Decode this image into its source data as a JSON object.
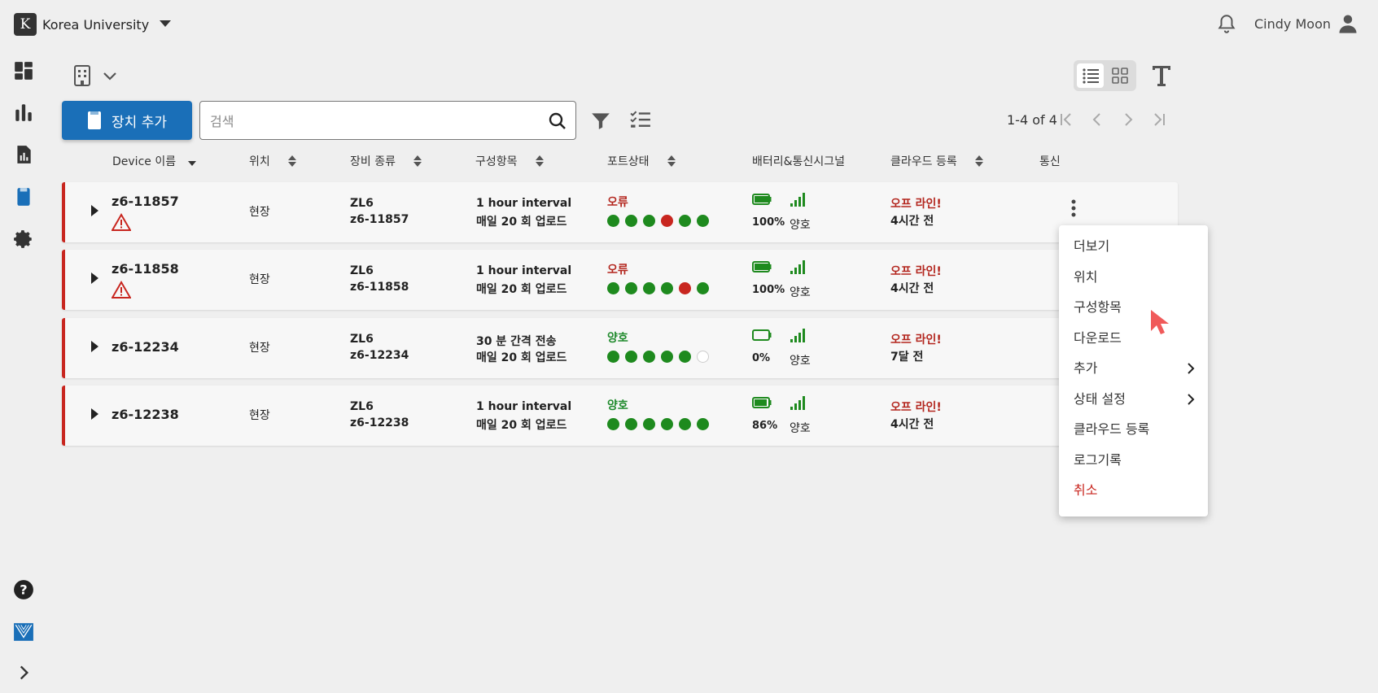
{
  "header": {
    "org_logo_letter": "K",
    "org_name": "Korea University",
    "user_name": "Cindy Moon"
  },
  "toolbar": {
    "add_device_label": "장치 추가",
    "search_placeholder": "검색",
    "pagination": "1-4 of 4"
  },
  "table": {
    "columns": [
      "Device 이름",
      "위치",
      "장비 종류",
      "구성항목",
      "포트상태",
      "배터리&통신시그널",
      "클라우드 등록",
      "통신"
    ],
    "rows": [
      {
        "name": "z6-11857",
        "warning": true,
        "location": "현장",
        "equip_type": "ZL6",
        "equip_id": "z6-11857",
        "config1": "1 hour interval",
        "config2": "매일 20 회 업로드",
        "port_status": "오류",
        "port_status_kind": "error",
        "ports": [
          "g",
          "g",
          "g",
          "r",
          "g",
          "g"
        ],
        "battery": "100%",
        "battery_level": 1.0,
        "signal": "양호",
        "cloud_status": "오프 라인!",
        "cloud_time": "4시간 전"
      },
      {
        "name": "z6-11858",
        "warning": true,
        "location": "현장",
        "equip_type": "ZL6",
        "equip_id": "z6-11858",
        "config1": "1 hour interval",
        "config2": "매일 20 회 업로드",
        "port_status": "오류",
        "port_status_kind": "error",
        "ports": [
          "g",
          "g",
          "g",
          "g",
          "r",
          "g"
        ],
        "battery": "100%",
        "battery_level": 1.0,
        "signal": "양호",
        "cloud_status": "오프 라인!",
        "cloud_time": "4시간 전"
      },
      {
        "name": "z6-12234",
        "warning": false,
        "location": "현장",
        "equip_type": "ZL6",
        "equip_id": "z6-12234",
        "config1": "30 분 간격 전송",
        "config2": "매일 20 회 업로드",
        "port_status": "양호",
        "port_status_kind": "ok",
        "ports": [
          "g",
          "g",
          "g",
          "g",
          "g",
          "e"
        ],
        "battery": "0%",
        "battery_level": 0.0,
        "signal": "양호",
        "cloud_status": "오프 라인!",
        "cloud_time": "7달 전"
      },
      {
        "name": "z6-12238",
        "warning": false,
        "location": "현장",
        "equip_type": "ZL6",
        "equip_id": "z6-12238",
        "config1": "1 hour interval",
        "config2": "매일 20 회 업로드",
        "port_status": "양호",
        "port_status_kind": "ok",
        "ports": [
          "g",
          "g",
          "g",
          "g",
          "g",
          "g"
        ],
        "battery": "86%",
        "battery_level": 0.86,
        "signal": "양호",
        "cloud_status": "오프 라인!",
        "cloud_time": "4시간 전"
      }
    ]
  },
  "context_menu": {
    "items": [
      {
        "label": "더보기",
        "submenu": false
      },
      {
        "label": "위치",
        "submenu": false
      },
      {
        "label": "구성항목",
        "submenu": false
      },
      {
        "label": "다운로드",
        "submenu": false
      },
      {
        "label": "추가",
        "submenu": true
      },
      {
        "label": "상태 설정",
        "submenu": true
      },
      {
        "label": "클라우드 등록",
        "submenu": false
      },
      {
        "label": "로그기록",
        "submenu": false
      },
      {
        "label": "취소",
        "submenu": false,
        "danger": true
      }
    ]
  },
  "colors": {
    "primary": "#1a6fb8",
    "error": "#c8261f",
    "ok": "#1e8a1e"
  }
}
